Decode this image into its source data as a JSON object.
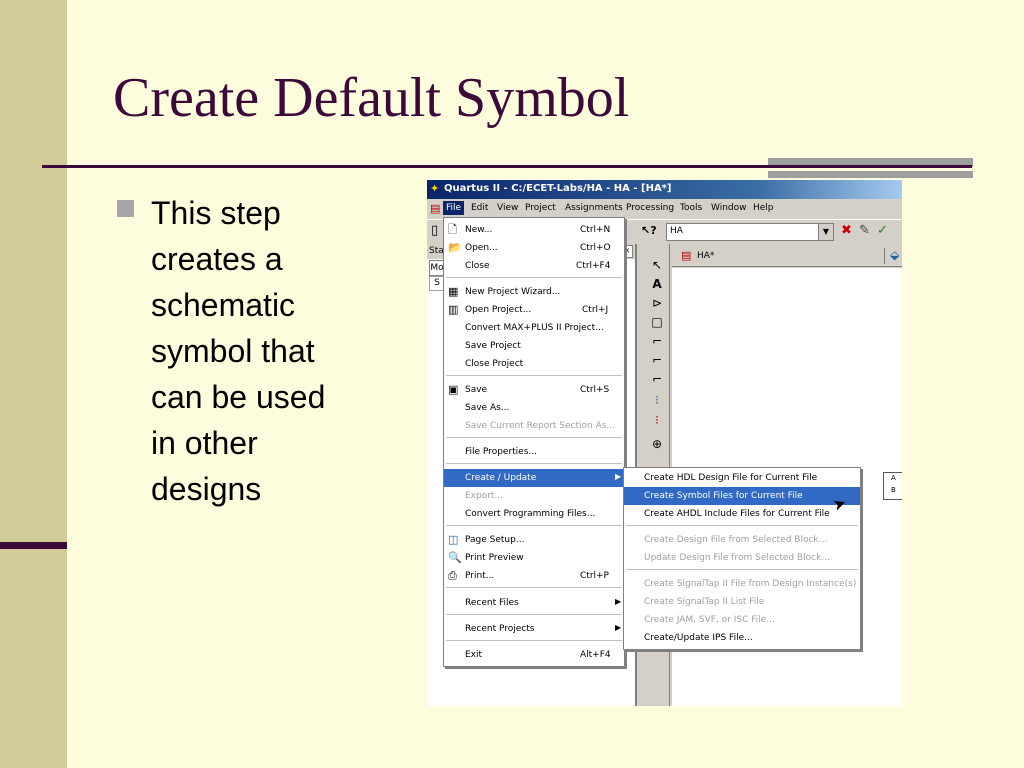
{
  "slide": {
    "title": "Create Default Symbol",
    "bullet": [
      "This step",
      "creates a",
      "schematic",
      "symbol that",
      "can be used",
      "in other",
      "designs"
    ]
  },
  "window": {
    "title": "Quartus II - C:/ECET-Labs/HA - HA - [HA*]",
    "menus": [
      "File",
      "Edit",
      "View",
      "Project",
      "Assignments",
      "Processing",
      "Tools",
      "Window",
      "Help"
    ],
    "active_menu": "File",
    "combo_value": "HA",
    "left_pane_title": "Sta",
    "left_tab": "Mo",
    "left_row": "S",
    "doc_tab": "HA*",
    "symbol_pins": [
      "A",
      "B"
    ]
  },
  "file_menu": {
    "items": [
      {
        "label": "New...",
        "accel": "Ctrl+N",
        "icon": "new-icon",
        "enabled": true
      },
      {
        "label": "Open...",
        "accel": "Ctrl+O",
        "icon": "open-icon",
        "enabled": true
      },
      {
        "label": "Close",
        "accel": "Ctrl+F4",
        "enabled": true
      },
      {
        "label": "New Project Wizard...",
        "icon": "wizard-icon",
        "enabled": true
      },
      {
        "label": "Open Project...",
        "accel": "Ctrl+J",
        "icon": "open-project-icon",
        "enabled": true
      },
      {
        "label": "Convert MAX+PLUS II Project...",
        "enabled": true
      },
      {
        "label": "Save Project",
        "enabled": true
      },
      {
        "label": "Close Project",
        "enabled": true
      },
      {
        "label": "Save",
        "accel": "Ctrl+S",
        "icon": "save-icon",
        "enabled": true
      },
      {
        "label": "Save As...",
        "enabled": true
      },
      {
        "label": "Save Current Report Section As...",
        "enabled": false
      },
      {
        "label": "File Properties...",
        "enabled": true
      },
      {
        "label": "Create / Update",
        "submenu": true,
        "enabled": true,
        "highlighted": true
      },
      {
        "label": "Export...",
        "enabled": false
      },
      {
        "label": "Convert Programming Files...",
        "enabled": true
      },
      {
        "label": "Page Setup...",
        "icon": "page-setup-icon",
        "enabled": true
      },
      {
        "label": "Print Preview",
        "icon": "print-preview-icon",
        "enabled": true
      },
      {
        "label": "Print...",
        "accel": "Ctrl+P",
        "icon": "print-icon",
        "enabled": true
      },
      {
        "label": "Recent Files",
        "submenu": true,
        "enabled": true
      },
      {
        "label": "Recent Projects",
        "submenu": true,
        "enabled": true
      },
      {
        "label": "Exit",
        "accel": "Alt+F4",
        "enabled": true
      }
    ]
  },
  "create_submenu": {
    "items": [
      {
        "label": "Create HDL Design File for Current File",
        "enabled": true
      },
      {
        "label": "Create Symbol Files for Current File",
        "enabled": true,
        "highlighted": true
      },
      {
        "label": "Create AHDL Include Files for Current File",
        "enabled": true
      },
      {
        "label": "Create Design File from Selected Block...",
        "enabled": false
      },
      {
        "label": "Update Design File from Selected Block...",
        "enabled": false
      },
      {
        "label": "Create SignalTap II File from Design Instance(s)",
        "enabled": false
      },
      {
        "label": "Create SignalTap II List File",
        "enabled": false
      },
      {
        "label": "Create JAM, SVF, or ISC File...",
        "enabled": false
      },
      {
        "label": "Create/Update IPS File...",
        "enabled": true
      }
    ]
  },
  "colors": {
    "title_text": "#3c0a3a",
    "slide_bg": "#fdfcdc",
    "side_band": "#cfcc9a",
    "menu_highlight": "#316ac5",
    "titlebar": "#0a246a"
  }
}
